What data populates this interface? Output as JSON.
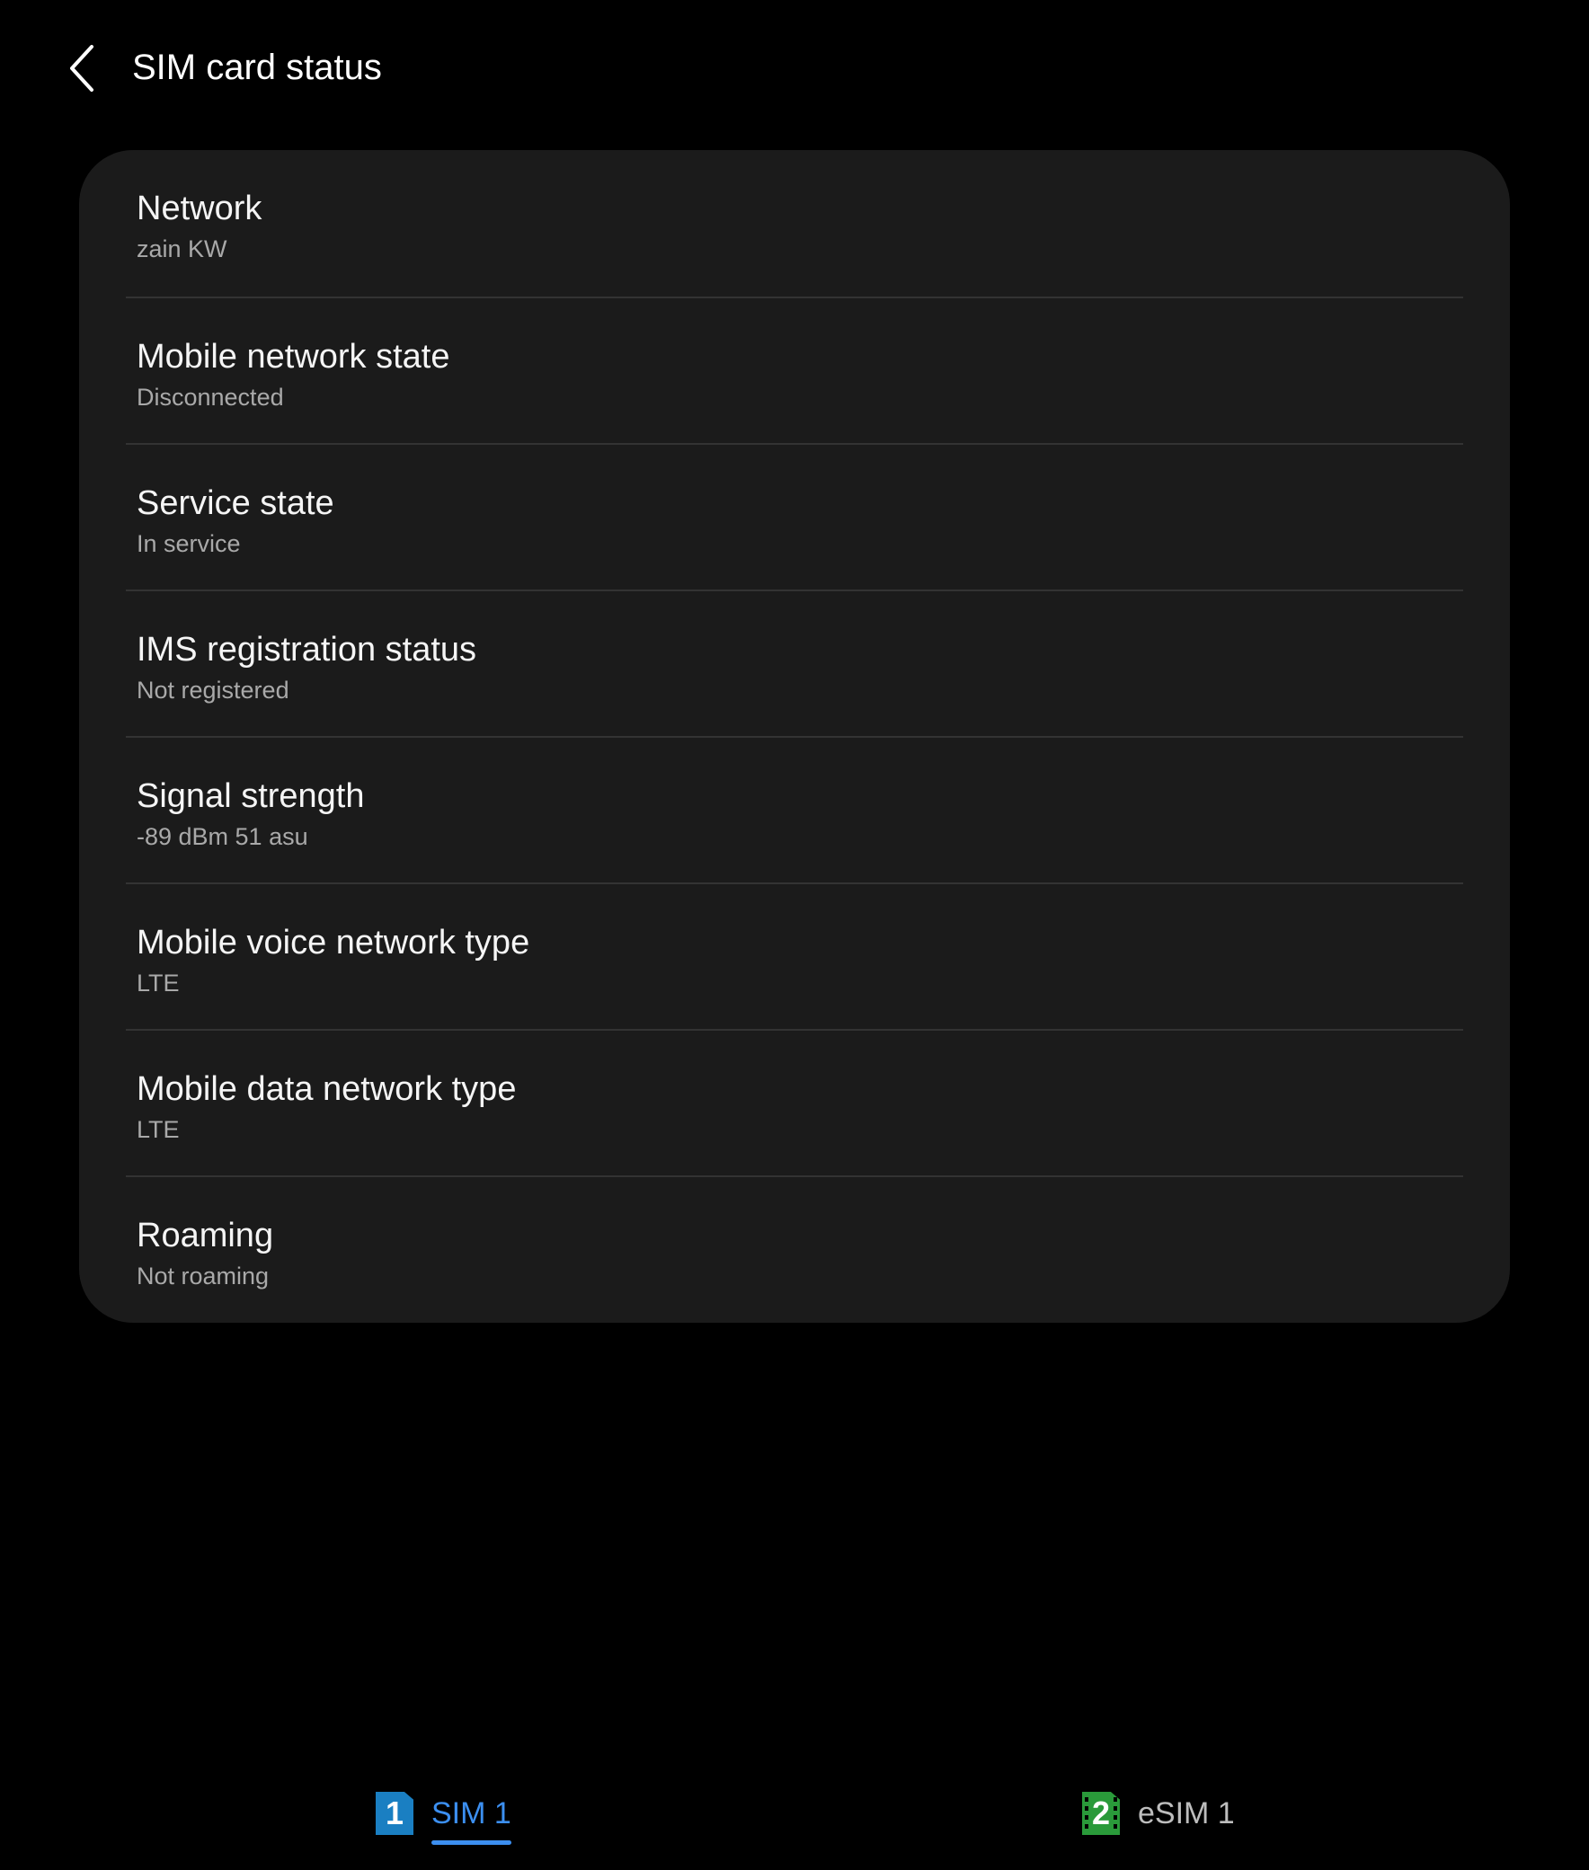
{
  "header": {
    "title": "SIM card status",
    "back_icon": "chevron-left-icon"
  },
  "items": [
    {
      "title": "Network",
      "value": "zain KW"
    },
    {
      "title": "Mobile network state",
      "value": "Disconnected"
    },
    {
      "title": "Service state",
      "value": "In service"
    },
    {
      "title": "IMS registration status",
      "value": "Not registered"
    },
    {
      "title": "Signal strength",
      "value": "-89 dBm 51 asu"
    },
    {
      "title": "Mobile voice network type",
      "value": "LTE"
    },
    {
      "title": "Mobile data network type",
      "value": "LTE"
    },
    {
      "title": "Roaming",
      "value": "Not roaming"
    }
  ],
  "tabs": [
    {
      "badge": "1",
      "label": "SIM 1",
      "selected": true,
      "badge_color": "#1a7fc2"
    },
    {
      "badge": "2",
      "label": "eSIM 1",
      "selected": false,
      "badge_color": "#2a9a3a"
    }
  ],
  "colors": {
    "background": "#000000",
    "card": "#1b1b1b",
    "accent": "#3c8ff0"
  }
}
